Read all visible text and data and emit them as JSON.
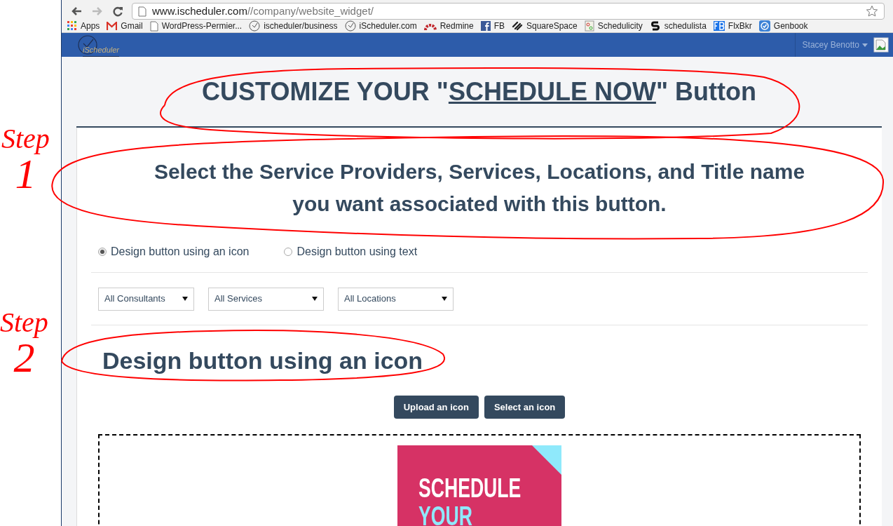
{
  "browser": {
    "address_host": "www.ischeduler.com",
    "address_path": "//company/website_widget/",
    "bookmarks": [
      {
        "kind": "apps",
        "label": "Apps"
      },
      {
        "kind": "gmail",
        "label": "Gmail"
      },
      {
        "kind": "page",
        "label": "WordPress-Permier..."
      },
      {
        "kind": "clock",
        "label": "ischeduler/business"
      },
      {
        "kind": "clock",
        "label": "iScheduler.com"
      },
      {
        "kind": "redmine",
        "label": "Redmine"
      },
      {
        "kind": "fb",
        "label": "FB"
      },
      {
        "kind": "squarespace",
        "label": "SquareSpace"
      },
      {
        "kind": "schedulicity",
        "label": "Schedulicity"
      },
      {
        "kind": "schedulista",
        "label": "schedulista"
      },
      {
        "kind": "flxbkr",
        "label": "FlxBkr"
      },
      {
        "kind": "genbook",
        "label": "Genbook"
      }
    ]
  },
  "header": {
    "logo_text": "iScheduler",
    "user_name": "Stacey Benotto"
  },
  "page": {
    "title_before": "CUSTOMIZE YOUR \"",
    "title_link": "SCHEDULE NOW",
    "title_after": "\" Button",
    "step1_heading": "Select the Service Providers, Services, Locations, and Title name you want associated with this button.",
    "design_options": [
      {
        "label": "Design button using an icon",
        "selected": true
      },
      {
        "label": "Design button using text",
        "selected": false
      }
    ],
    "filters": [
      {
        "value": "All Consultants"
      },
      {
        "value": "All Services"
      },
      {
        "value": "All Locations"
      }
    ],
    "step2_heading": "Design button using an icon",
    "buttons": [
      "Upload an icon",
      "Select an icon"
    ],
    "preview_image": {
      "line_1": "SCHEDULE",
      "line_2": "YOUR"
    }
  },
  "annotations": [
    {
      "word": "Step",
      "number": "1"
    },
    {
      "word": "Step",
      "number": "2"
    }
  ]
}
